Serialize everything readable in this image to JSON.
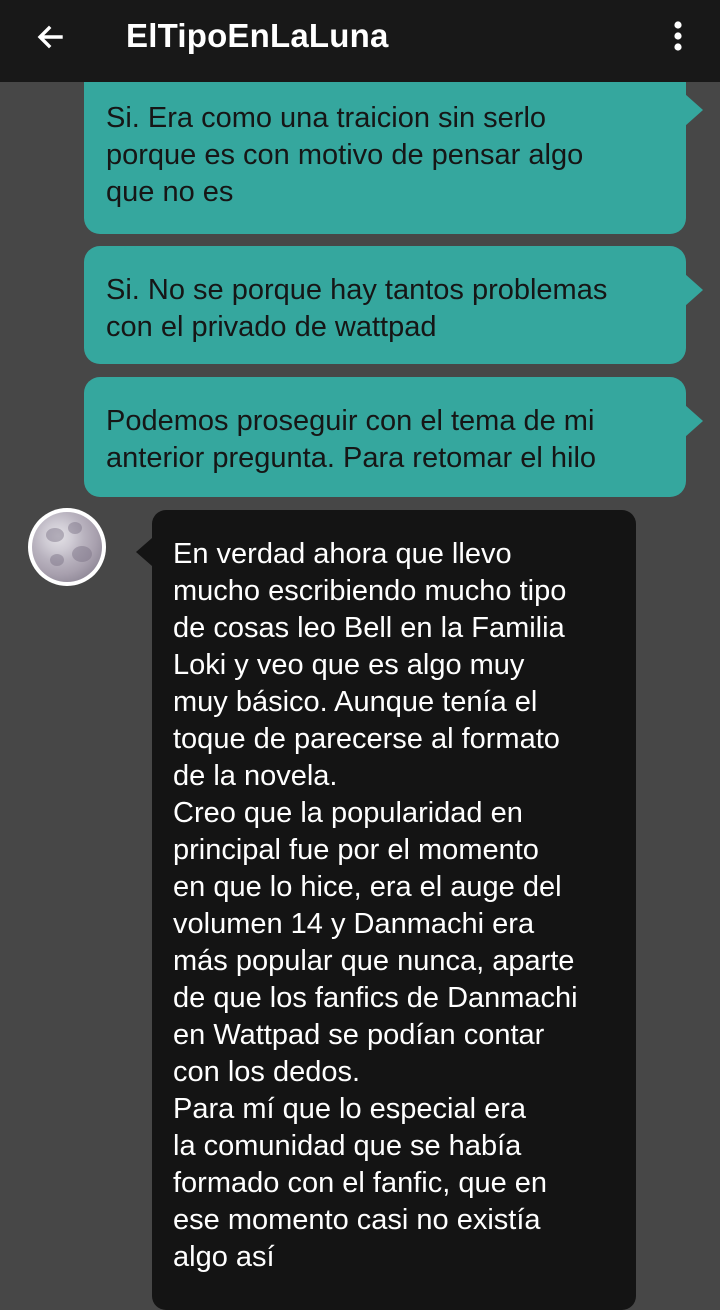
{
  "header": {
    "title": "ElTipoEnLaLuna",
    "back_icon": "arrow-left-icon",
    "menu_icon": "more-vertical-icon",
    "background_color": "#181818"
  },
  "theme": {
    "chat_background": "#474747",
    "outgoing_bubble_color": "#35a79e",
    "incoming_bubble_color": "#141414"
  },
  "messages": [
    {
      "direction": "outgoing",
      "text": "Si. Era como una traicion sin serlo\nporque es con motivo de pensar algo\nque no es"
    },
    {
      "direction": "outgoing",
      "text": "Si. No se porque hay tantos problemas\ncon el privado de wattpad"
    },
    {
      "direction": "outgoing",
      "text": "Podemos proseguir con el tema de mi\nanterior pregunta. Para retomar el hilo"
    },
    {
      "direction": "incoming",
      "avatar": "moon-avatar",
      "text": "En verdad ahora que llevo\nmucho escribiendo mucho tipo\nde cosas leo Bell en la Familia\nLoki y veo que es algo muy\nmuy básico. Aunque tenía el\ntoque de parecerse al formato\nde la novela.\nCreo que la popularidad en\nprincipal fue por el momento\nen que lo hice, era el auge del\nvolumen 14 y Danmachi era\nmás popular que nunca, aparte\nde que los fanfics de Danmachi\nen Wattpad se podían contar\ncon los dedos.\nPara mí que lo especial era\nla comunidad que se había\nformado con el fanfic, que en\nese momento casi no existía\nalgo así"
    }
  ]
}
